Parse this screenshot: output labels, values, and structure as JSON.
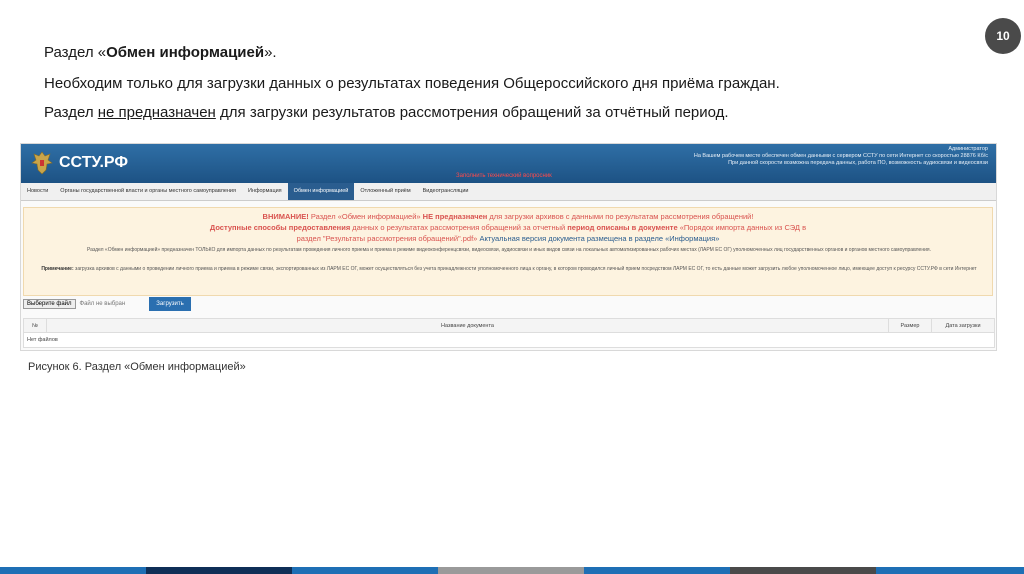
{
  "slide": {
    "number": "10",
    "line1_prefix": "Раздел «",
    "line1_bold": "Обмен информацией",
    "line1_suffix": "».",
    "line2": "Необходим только для загрузки данных о результатах поведения Общероссийского дня приёма граждан.",
    "line3_prefix": "Раздел ",
    "line3_underlined": "не предназначен",
    "line3_suffix": " для загрузки результатов рассмотрения обращений за отчётный период.",
    "caption": "Рисунок 6. Раздел «Обмен информацией»"
  },
  "app": {
    "title": "ССТУ.РФ",
    "header_right": {
      "line1": "Администратор",
      "line2": "На Вашем рабочем месте обеспечен обмен данными с сервером ССТУ по сети Интернет со скоростью 28876 Кб/с",
      "line3": "При данной скорости возможна передача данных, работа ПО, возможность аудиосвязи и видеосвязи"
    },
    "header_alert": "Заполнить технический вопросник",
    "nav": [
      {
        "label": "Новости"
      },
      {
        "label": "Органы государственной власти и органы местного самоуправления"
      },
      {
        "label": "Информация"
      },
      {
        "label": "Обмен информацией"
      },
      {
        "label": "Отложенный приём"
      },
      {
        "label": "Видеотрансляции"
      }
    ],
    "warning": {
      "w1_bold_a": "ВНИМАНИЕ!",
      "w1_text_a": " Раздел «Обмен информацией» ",
      "w1_bold_b": "НЕ предназначен",
      "w1_text_b": " для загрузки архивов с данными по результатам рассмотрения обращений!",
      "w2_bold_a": "Доступные способы предоставления",
      "w2_text_a": " данных о результатах рассмотрения обращений за отчетный ",
      "w2_bold_b": "период описаны в документе",
      "w2_text_b": " «Порядок импорта данных из СЭД в",
      "w3_text_a": "раздел \"Результаты рассмотрения обращений\".pdf»",
      "w3_text_b": " Актуальная версия документа размещена в разделе «Информация»",
      "info": "Раздел «Обмен информацией» предназначен ТОЛЬКО для импорта данных по результатам проведения личного приема и приема в режиме видеоконференцсвязи, видеосвязи, аудиосвязи и иных видов связи на локальных автоматизированных рабочих местах (ЛАРМ ЕС ОГ) уполномоченных лиц государственных органов и органов местного самоуправления.",
      "note_label": "Примечание:",
      "note": " загрузка архивов с данными о проведении личного приема и приема в режиме связи, экспортированных из ЛАРМ ЕС ОГ, может осуществляться без учета принадлежности уполномоченного лица к органу, в котором проводился личный прием посредством ЛАРМ ЕС ОГ, то есть данные может загрузить любое уполномоченное лицо, имеющее доступ к ресурсу ССТУ.РФ в сети Интернет"
    },
    "file_button": "Выберите файл",
    "file_none": "Файл не выбран",
    "upload_button": "Загрузить",
    "table": {
      "headers": [
        "№",
        "Название документа",
        "Размер",
        "Дата загрузки"
      ],
      "empty": "Нет файлов"
    }
  },
  "colors": {
    "header_blue": "#1d5284",
    "nav_active": "#2a5d8f",
    "warning_red": "#d9534f",
    "footer_segments": [
      "#1e6fb5",
      "#0f2f57",
      "#1e6fb5",
      "#9a9a9a",
      "#1e6fb5",
      "#4a4a4a",
      "#1e6fb5"
    ]
  }
}
